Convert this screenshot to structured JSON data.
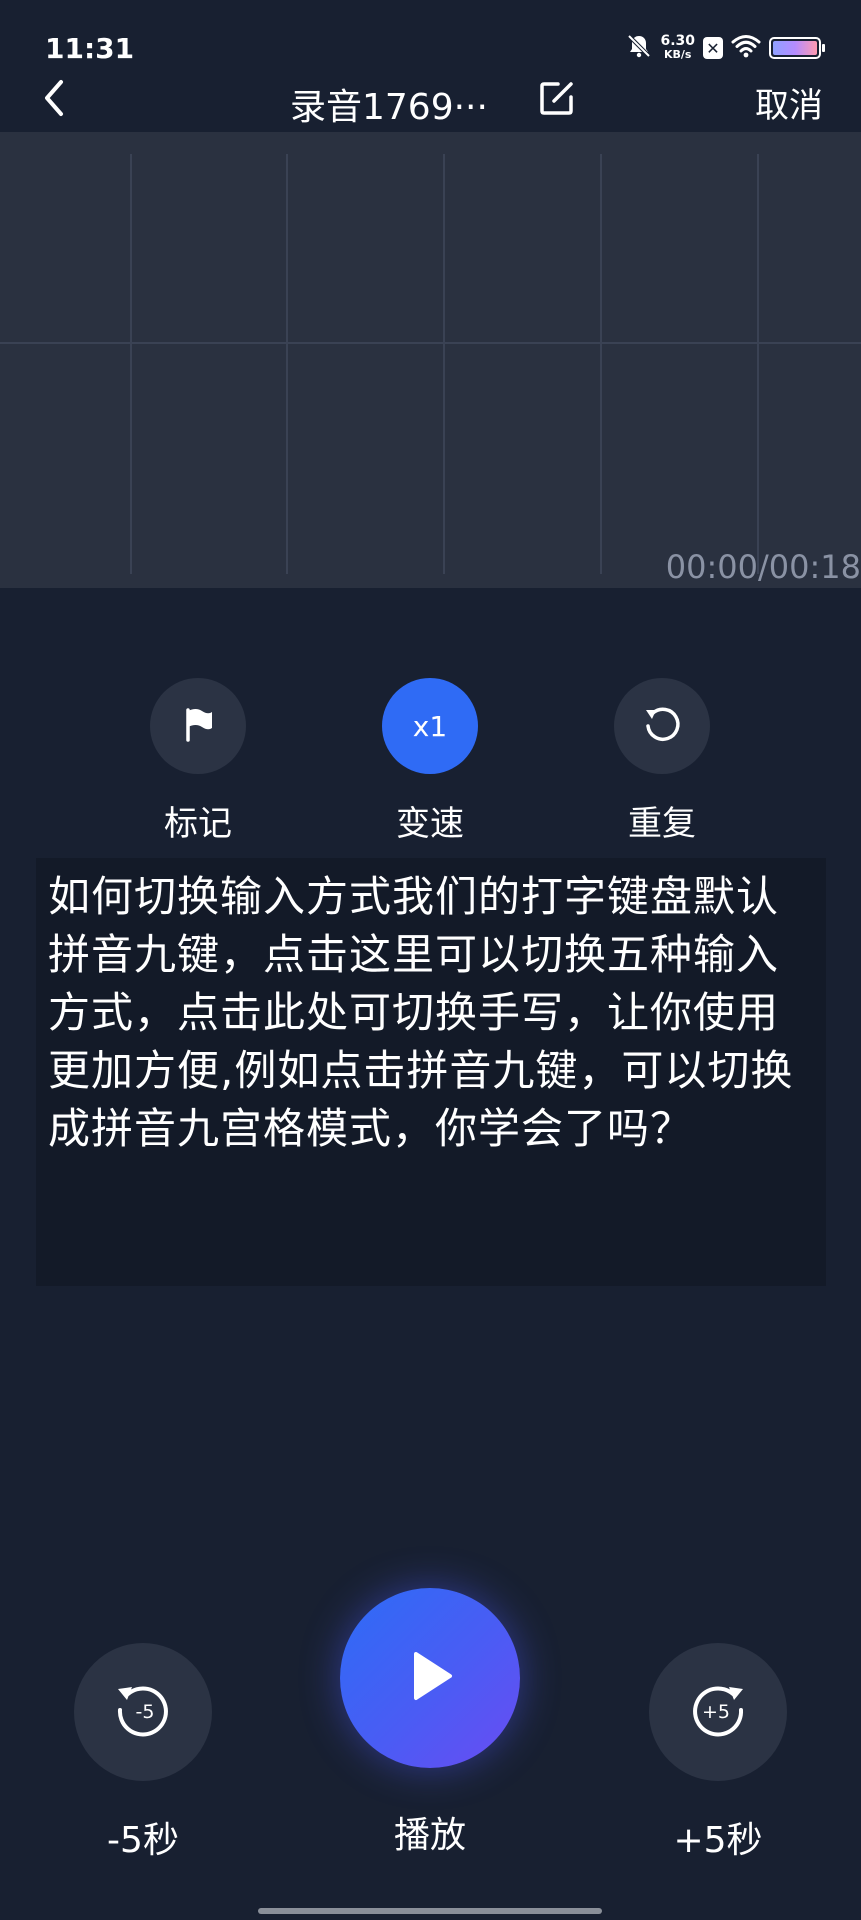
{
  "status_bar": {
    "time": "11:31",
    "net_speed_value": "6.30",
    "net_speed_unit": "KB/s",
    "icons": [
      "bell-muted-icon",
      "x-badge-icon",
      "wifi-icon",
      "battery-icon"
    ],
    "x_badge": "✕"
  },
  "header": {
    "title": "录音1769···",
    "cancel_label": "取消",
    "icons": [
      "back-icon",
      "edit-icon"
    ]
  },
  "player": {
    "timecode": "00:00/00:18"
  },
  "controls": [
    {
      "id": "mark",
      "label": "标记",
      "icon": "flag-icon"
    },
    {
      "id": "speed",
      "label": "变速",
      "value": "x1"
    },
    {
      "id": "repeat",
      "label": "重复",
      "icon": "repeat-icon"
    }
  ],
  "transcript": {
    "text": "如何切换输入方式我们的打字键盘默认拼音九键，点击这里可以切换五种输入方式，点击此处可切换手写，让你使用更加方便,例如点击拼音九键，可以切换成拼音九宫格模式，你学会了吗？"
  },
  "bottom_controls": {
    "rewind_label": "-5秒",
    "rewind_icon_text": "-5",
    "play_label": "播放",
    "forward_label": "+5秒",
    "forward_icon_text": "+5",
    "icons": [
      "rewind-5-icon",
      "play-icon",
      "forward-5-icon"
    ]
  },
  "colors": {
    "background": "#182031",
    "waveform_bg": "#2a3140",
    "accent": "#2f6bf5",
    "button_bg": "#2b3344"
  }
}
